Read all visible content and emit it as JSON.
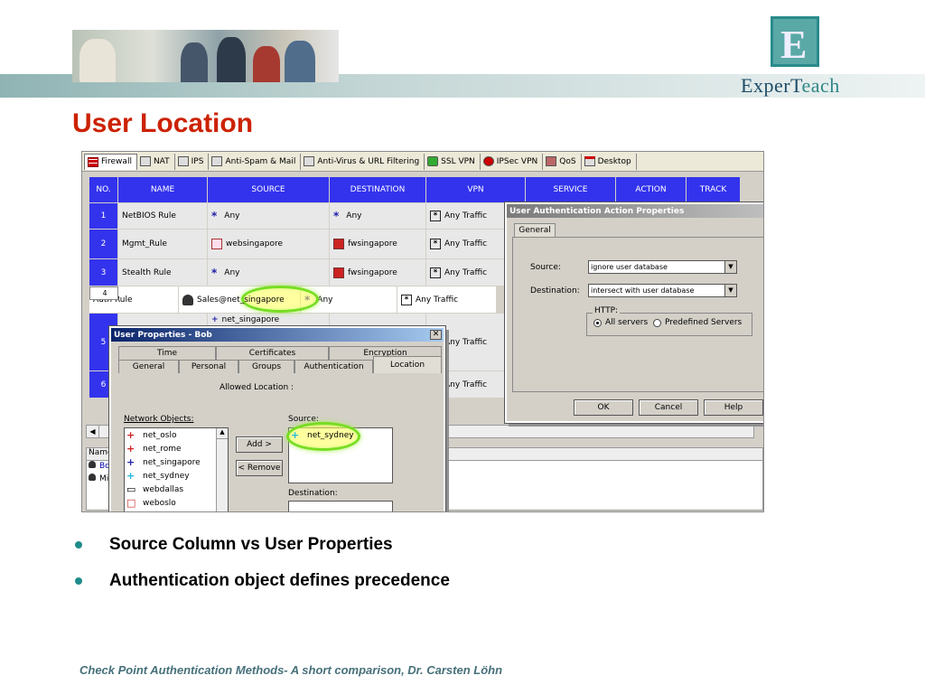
{
  "slide": {
    "title": "User Location",
    "logo_e": "E",
    "logo_text_a": "ExperT",
    "logo_text_b": "each",
    "bullets": [
      "Source Column vs User Properties",
      "Authentication object defines precedence"
    ],
    "footer": "Check Point Authentication Methods- A short comparison,   Dr. Carsten Löhn"
  },
  "toolbar": {
    "tabs": [
      "Firewall",
      "NAT",
      "IPS",
      "Anti-Spam & Mail",
      "Anti-Virus & URL Filtering",
      "SSL VPN",
      "IPSec VPN",
      "QoS",
      "Desktop"
    ]
  },
  "rules": {
    "headers": [
      "NO.",
      "NAME",
      "SOURCE",
      "DESTINATION",
      "VPN",
      "SERVICE",
      "ACTION",
      "TRACK"
    ],
    "rows": [
      {
        "no": "1",
        "name": "NetBIOS Rule",
        "source": "Any",
        "destination": "Any",
        "vpn": "Any Traffic"
      },
      {
        "no": "2",
        "name": "Mgmt_Rule",
        "source": "websingapore",
        "destination": "fwsingapore",
        "vpn": "Any Traffic"
      },
      {
        "no": "3",
        "name": "Stealth Rule",
        "source": "Any",
        "destination": "fwsingapore",
        "vpn": "Any Traffic"
      },
      {
        "no": "4",
        "name": "Auth Rule",
        "source": "Sales@net_singapore",
        "destination": "Any",
        "vpn": "Any Traffic"
      },
      {
        "no": "5",
        "name": "",
        "source": "net_singapore",
        "destination": "",
        "vpn": "Any Traffic"
      },
      {
        "no": "6",
        "name": "",
        "source": "",
        "destination": "",
        "vpn": "Any Traffic"
      }
    ]
  },
  "lower_panel": {
    "header": "Name",
    "items": [
      "Bo",
      "Mi"
    ]
  },
  "user_props": {
    "title": "User Properties - Bob",
    "tabs_top": [
      "Time",
      "Certificates",
      "Encryption"
    ],
    "tabs_bottom": [
      "General",
      "Personal",
      "Groups",
      "Authentication",
      "Location"
    ],
    "allowed_location": "Allowed Location :",
    "network_objects_label": "Network Objects:",
    "network_objects": [
      "net_oslo",
      "net_rome",
      "net_singapore",
      "net_sydney",
      "webdallas",
      "weboslo"
    ],
    "add_label": "Add >",
    "remove_label": "< Remove",
    "source_label": "Source:",
    "source_items": [
      "net_sydney"
    ],
    "destination_label": "Destination:"
  },
  "auth_props": {
    "title": "User Authentication Action Properties",
    "tab": "General",
    "source_label": "Source:",
    "source_value": "ignore user database",
    "destination_label": "Destination:",
    "destination_value": "intersect with user database",
    "http_label": "HTTP:",
    "radio_all": "All servers",
    "radio_predefined": "Predefined Servers",
    "ok": "OK",
    "cancel": "Cancel",
    "help": "Help"
  },
  "colors": {
    "title_red": "#cc2200",
    "grid_header_blue": "#3333ee",
    "bullet_teal": "#1f8b8b",
    "highlight_green": "#77dd22"
  }
}
